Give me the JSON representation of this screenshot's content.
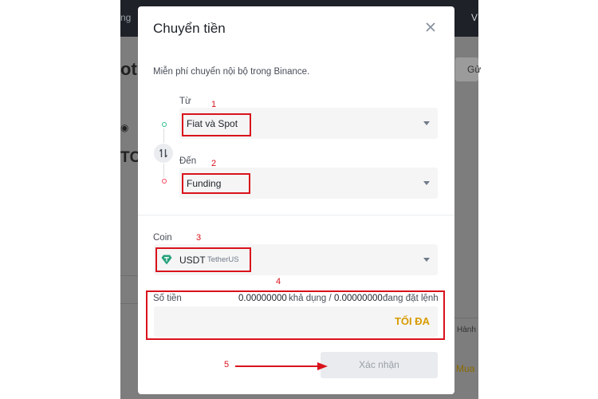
{
  "background": {
    "topbar_text_left": "ng",
    "topbar_text_right": "V",
    "heading_fragment": "ot",
    "label_fragment": "TC",
    "button_fragment": "Gử",
    "column_fragment": "Hành",
    "link_fragment": "Mua"
  },
  "modal": {
    "title": "Chuyển tiền",
    "subtitle": "Miễn phí chuyển nội bộ trong Binance.",
    "from": {
      "label": "Từ",
      "value": "Fiat và Spot"
    },
    "to": {
      "label": "Đến",
      "value": "Funding"
    },
    "coin": {
      "label": "Coin",
      "symbol": "USDT",
      "name": "TetherUS",
      "icon": "tether-icon"
    },
    "amount": {
      "label": "Số tiền",
      "available_value": "0.00000000",
      "available_label": "khả dụng /",
      "pending_value": "0.00000000",
      "pending_label": "đang đặt lệnh",
      "max_label": "TỐI ĐA"
    },
    "confirm_label": "Xác nhận"
  },
  "annotations": {
    "n1": "1",
    "n2": "2",
    "n3": "3",
    "n4": "4",
    "n5": "5"
  },
  "colors": {
    "annotation": "#d9121c",
    "max_accent": "#d89b00",
    "from_dot": "#2ebd85",
    "to_dot": "#f6465d",
    "tether": "#26a17b"
  }
}
